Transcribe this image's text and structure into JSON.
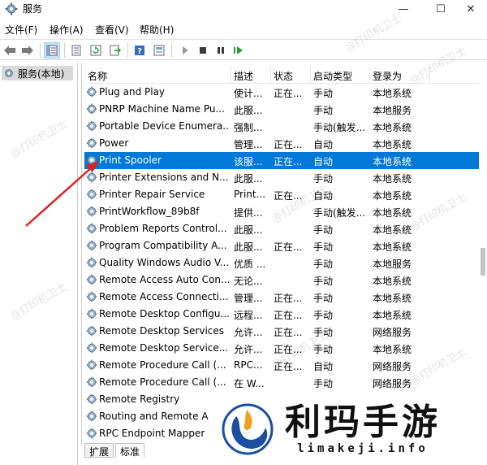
{
  "window": {
    "title": "服务",
    "minimize_glyph": "—",
    "maximize_glyph": "☐",
    "close_glyph": "✕"
  },
  "menu": [
    {
      "label": "文件(F)"
    },
    {
      "label": "操作(A)"
    },
    {
      "label": "查看(V)"
    },
    {
      "label": "帮助(H)"
    }
  ],
  "toolbar": {
    "icons": [
      "back-arrow-icon",
      "forward-arrow-icon",
      "show-hide-tree-icon",
      "properties-icon",
      "refresh-icon",
      "export-list-icon",
      "help-icon",
      "view-icon",
      "start-icon",
      "stop-icon",
      "pause-icon",
      "restart-icon"
    ]
  },
  "tree": {
    "item_label": "服务(本地)"
  },
  "table": {
    "headers": [
      "名称",
      "描述",
      "状态",
      "启动类型",
      "登录为"
    ],
    "rows": [
      {
        "name": "Plug and Play",
        "desc": "使计...",
        "status": "正在...",
        "start": "手动",
        "login": "本地系统"
      },
      {
        "name": "PNRP Machine Name Pu...",
        "desc": "此服...",
        "status": "",
        "start": "手动",
        "login": "本地服务"
      },
      {
        "name": "Portable Device Enumera...",
        "desc": "强制...",
        "status": "",
        "start": "手动(触发...",
        "login": "本地系统"
      },
      {
        "name": "Power",
        "desc": "管理...",
        "status": "正在...",
        "start": "自动",
        "login": "本地系统"
      },
      {
        "name": "Print Spooler",
        "desc": "该服...",
        "status": "正在...",
        "start": "自动",
        "login": "本地系统"
      },
      {
        "name": "Printer Extensions and N...",
        "desc": "此服...",
        "status": "",
        "start": "手动",
        "login": "本地系统"
      },
      {
        "name": "Printer Repair Service",
        "desc": "Print...",
        "status": "正在...",
        "start": "自动",
        "login": "本地系统"
      },
      {
        "name": "PrintWorkflow_89b8f",
        "desc": "提供...",
        "status": "",
        "start": "手动(触发...",
        "login": "本地系统"
      },
      {
        "name": "Problem Reports Control...",
        "desc": "此服...",
        "status": "",
        "start": "手动",
        "login": "本地系统"
      },
      {
        "name": "Program Compatibility A...",
        "desc": "此服...",
        "status": "正在...",
        "start": "手动",
        "login": "本地系统"
      },
      {
        "name": "Quality Windows Audio V...",
        "desc": "优质 ...",
        "status": "",
        "start": "手动",
        "login": "本地服务"
      },
      {
        "name": "Remote Access Auto Con...",
        "desc": "无论...",
        "status": "",
        "start": "手动",
        "login": "本地系统"
      },
      {
        "name": "Remote Access Connecti...",
        "desc": "管理...",
        "status": "正在...",
        "start": "手动",
        "login": "本地系统"
      },
      {
        "name": "Remote Desktop Configu...",
        "desc": "远程...",
        "status": "正在...",
        "start": "手动",
        "login": "本地系统"
      },
      {
        "name": "Remote Desktop Services",
        "desc": "允许...",
        "status": "正在...",
        "start": "手动",
        "login": "网络服务"
      },
      {
        "name": "Remote Desktop Service...",
        "desc": "允许...",
        "status": "正在...",
        "start": "手动",
        "login": "本地系统"
      },
      {
        "name": "Remote Procedure Call (...",
        "desc": "RPC...",
        "status": "正在...",
        "start": "自动",
        "login": "网络服务"
      },
      {
        "name": "Remote Procedure Call (...",
        "desc": "在 W...",
        "status": "",
        "start": "手动",
        "login": "网络服务"
      },
      {
        "name": "Remote Registry",
        "desc": "",
        "status": "",
        "start": "",
        "login": ""
      },
      {
        "name": "Routing and Remote A",
        "desc": "",
        "status": "",
        "start": "",
        "login": ""
      },
      {
        "name": "RPC Endpoint Mapper",
        "desc": "",
        "status": "",
        "start": "",
        "login": ""
      }
    ]
  },
  "tabs": [
    {
      "label": "扩展"
    },
    {
      "label": "标准"
    }
  ],
  "watermark_text": "@打印机卫士",
  "logo": {
    "cn": "利玛手游",
    "url": "limakeji.info"
  },
  "colors": {
    "selection": "#0078d7",
    "annotation_arrow": "#e02020"
  }
}
